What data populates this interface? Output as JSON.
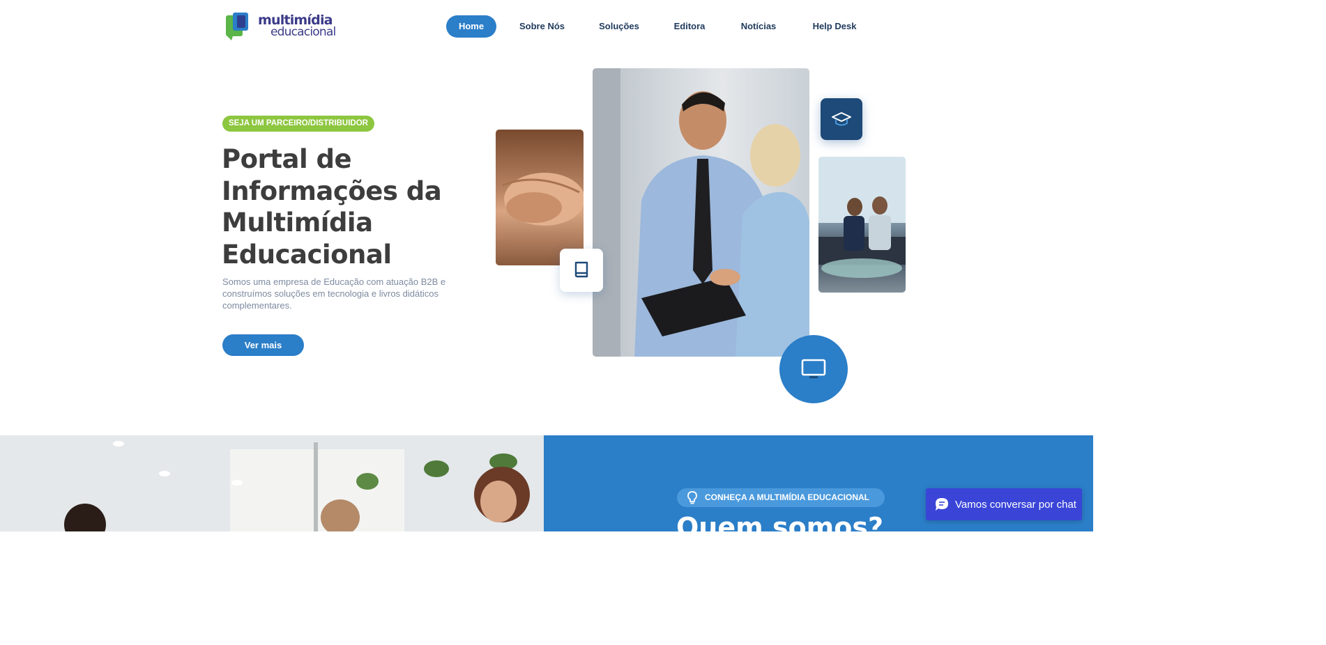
{
  "header": {
    "logo": {
      "line1": "multimídia",
      "line2": "educacional"
    },
    "nav": [
      {
        "label": "Home",
        "active": true
      },
      {
        "label": "Sobre Nós",
        "active": false
      },
      {
        "label": "Soluções",
        "active": false
      },
      {
        "label": "Editora",
        "active": false
      },
      {
        "label": "Notícias",
        "active": false
      },
      {
        "label": "Help Desk",
        "active": false
      }
    ]
  },
  "hero": {
    "badge": "SEJA UM PARCEIRO/DISTRIBUIDOR",
    "title": "Portal de Informações da Multimídia Educacional",
    "subtitle": "Somos uma empresa de Educação com atuação B2B e construímos soluções em tecnologia e livros didáticos complementares.",
    "cta": "Ver mais",
    "icons": [
      "book-icon",
      "graduation-cap-icon",
      "monitor-icon"
    ]
  },
  "about": {
    "pill": "CONHEÇA A MULTIMÍDIA EDUCACIONAL",
    "pill_icon": "lightbulb-icon",
    "title": "Quem somos?"
  },
  "chat": {
    "label": "Vamos conversar por chat",
    "icon": "chat-bubble-icon"
  },
  "colors": {
    "primary": "#2b7ec8",
    "green": "#8dc63f",
    "dark_blue": "#1d4a78",
    "chat": "#3a45d8"
  }
}
